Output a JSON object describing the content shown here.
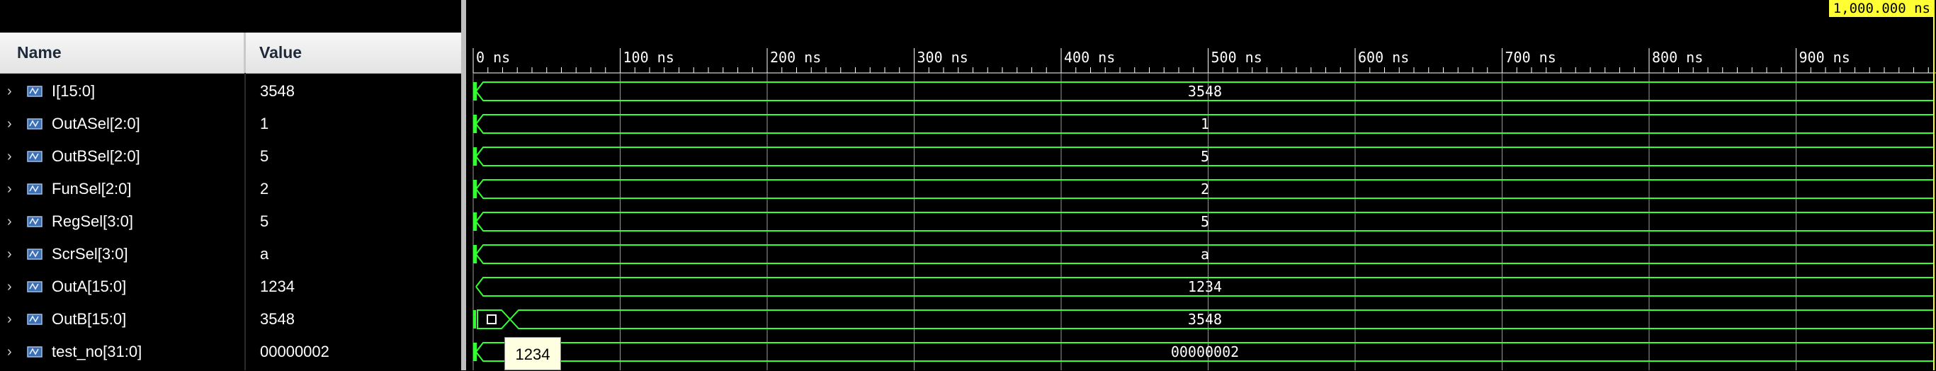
{
  "panel": {
    "name_header": "Name",
    "value_header": "Value"
  },
  "signals": [
    {
      "name": "I[15:0]",
      "value": "3548",
      "wave_label": "3548"
    },
    {
      "name": "OutASel[2:0]",
      "value": "1",
      "wave_label": "1"
    },
    {
      "name": "OutBSel[2:0]",
      "value": "5",
      "wave_label": "5"
    },
    {
      "name": "FunSel[2:0]",
      "value": "2",
      "wave_label": "2"
    },
    {
      "name": "RegSel[3:0]",
      "value": "5",
      "wave_label": "5"
    },
    {
      "name": "ScrSel[3:0]",
      "value": "a",
      "wave_label": "a"
    },
    {
      "name": "OutA[15:0]",
      "value": "1234",
      "wave_label": "1234"
    },
    {
      "name": "OutB[15:0]",
      "value": "3548",
      "wave_label": "3548",
      "initial_label": "0"
    },
    {
      "name": "test_no[31:0]",
      "value": "00000002",
      "wave_label": "00000002"
    }
  ],
  "timeline": {
    "cursor_readout": "1,000.000 ns",
    "ticks": [
      "0 ns",
      "100 ns",
      "200 ns",
      "300 ns",
      "400 ns",
      "500 ns",
      "600 ns",
      "700 ns",
      "800 ns",
      "900 ns"
    ]
  },
  "tooltip": {
    "text": "1234"
  },
  "colors": {
    "wave": "#33ff33",
    "cursor_bg": "#ffff33",
    "header_bg": "#ececec"
  },
  "icons": {
    "expand": "chevron-right-icon",
    "bus": "bus-signal-icon"
  }
}
